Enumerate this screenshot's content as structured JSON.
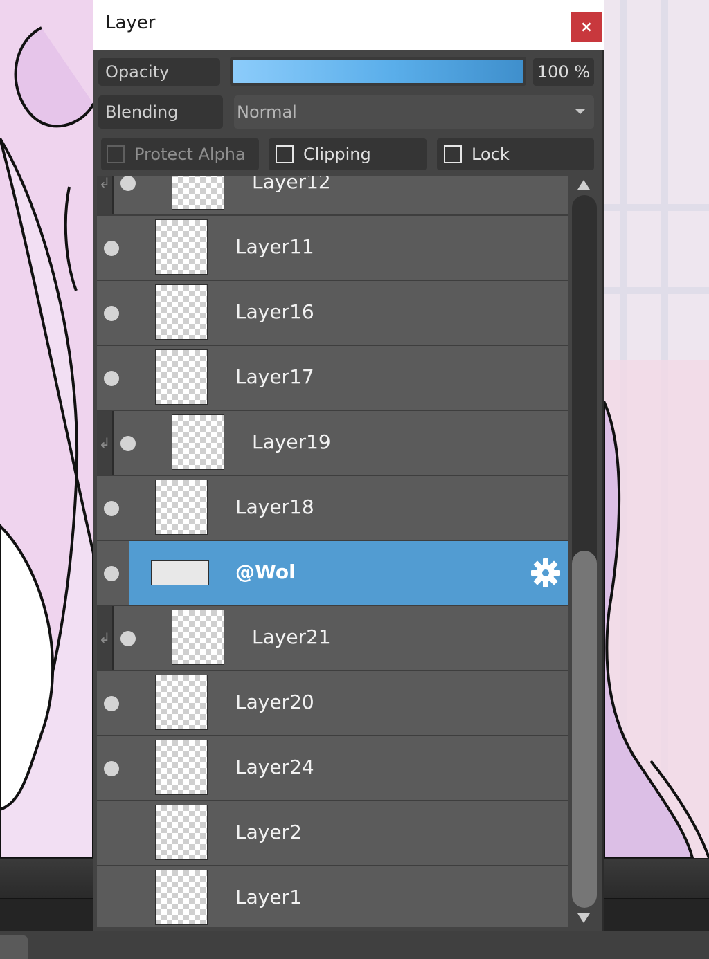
{
  "panel": {
    "title": "Layer",
    "close_glyph": "×"
  },
  "controls": {
    "opacity_label": "Opacity",
    "opacity_value": "100 %",
    "opacity_fraction": 1.0,
    "blending_label": "Blending",
    "blending_value": "Normal",
    "protect_alpha_label": "Protect Alpha",
    "clipping_label": "Clipping",
    "lock_label": "Lock"
  },
  "layers": [
    {
      "name": "Layer12",
      "clipped": true
    },
    {
      "name": "Layer11",
      "clipped": false
    },
    {
      "name": "Layer16",
      "clipped": false
    },
    {
      "name": "Layer17",
      "clipped": false
    },
    {
      "name": "Layer19",
      "clipped": true
    },
    {
      "name": "Layer18",
      "clipped": false
    },
    {
      "name": "@Wol",
      "clipped": false,
      "selected": true
    },
    {
      "name": "Layer21",
      "clipped": true
    },
    {
      "name": "Layer20",
      "clipped": false
    },
    {
      "name": "Layer24",
      "clipped": false
    },
    {
      "name": "Layer2",
      "clipped": false,
      "hidden": true
    },
    {
      "name": "Layer1",
      "clipped": false,
      "hidden": true
    }
  ],
  "colors": {
    "selected_row": "#529cd2",
    "close_button": "#c8383d",
    "opacity_fill": "#5aaeea"
  },
  "icons": {
    "close": "close-icon",
    "visibility": "eye-icon",
    "settings": "gear-icon",
    "clip": "clip-arrow-icon",
    "dropdown": "chevron-down-icon"
  }
}
